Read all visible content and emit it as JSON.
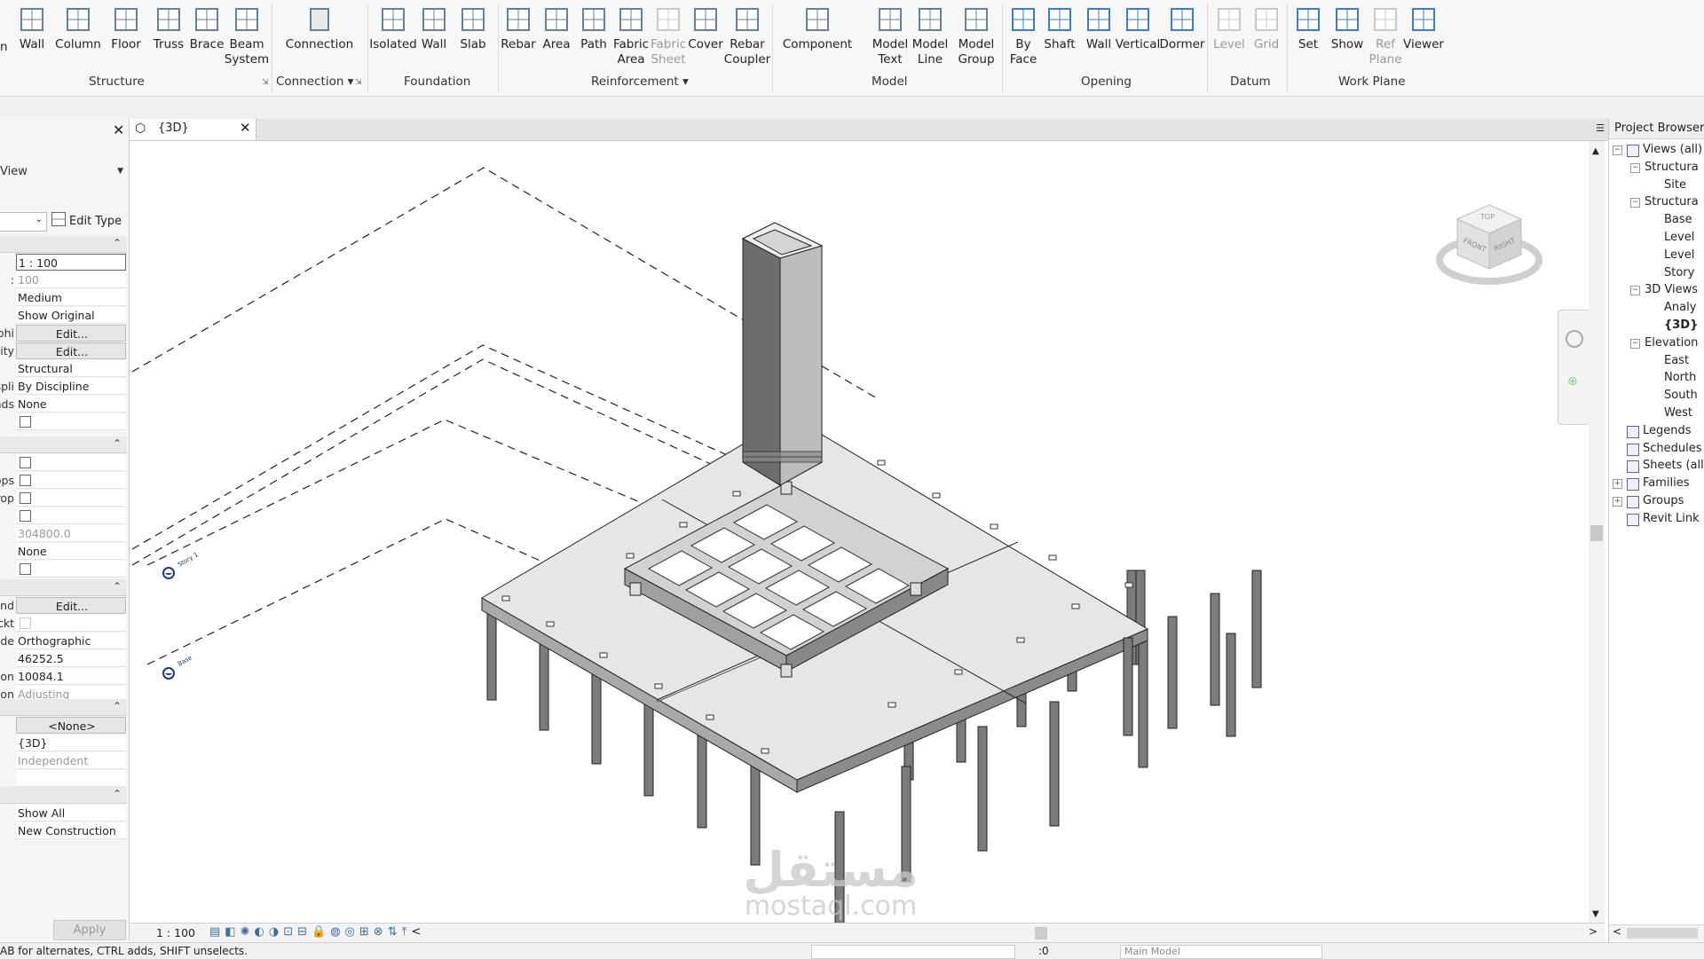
{
  "ribbon": {
    "structure": {
      "buttons": [
        "Wall",
        "Column",
        "Floor",
        "Truss",
        "Brace",
        "Beam\nSystem"
      ],
      "panel_label": "Structure",
      "partial_left": "n"
    },
    "connection": {
      "button": "Connection",
      "panel_label": "Connection ▾"
    },
    "foundation": {
      "buttons": [
        "Isolated",
        "Wall",
        "Slab"
      ],
      "panel_label": "Foundation"
    },
    "reinforcement": {
      "buttons": [
        "Rebar",
        "Area",
        "Path",
        "Fabric\nArea",
        "Fabric\nSheet",
        "Cover",
        "Rebar\nCoupler"
      ],
      "panel_label": "Reinforcement ▾"
    },
    "model": {
      "buttons": [
        "Component",
        "Model\nText",
        "Model\nLine",
        "Model\nGroup"
      ],
      "panel_label": "Model"
    },
    "opening": {
      "buttons": [
        "By\nFace",
        "Shaft",
        "Wall",
        "Vertical",
        "Dormer"
      ],
      "panel_label": "Opening"
    },
    "datum": {
      "buttons": [
        "Level",
        "Grid"
      ],
      "panel_label": "Datum"
    },
    "workplane": {
      "buttons": [
        "Set",
        "Show",
        "Ref\nPlane",
        "Viewer"
      ],
      "panel_label": "Work Plane"
    }
  },
  "properties": {
    "type_selector": "View",
    "edit_type": "Edit Type",
    "rows1": [
      {
        "label": "",
        "value": "1 : 100",
        "kind": "boxed"
      },
      {
        "label": ":",
        "value": "100",
        "kind": "gray"
      },
      {
        "label": "",
        "value": "Medium"
      },
      {
        "label": "",
        "value": "Show Original"
      },
      {
        "label": "Graphi...",
        "value": "Edit...",
        "kind": "btn"
      },
      {
        "label": "Visibility...",
        "value": "Edit...",
        "kind": "btn"
      },
      {
        "label": "",
        "value": "Structural"
      },
      {
        "label": "Displi...",
        "value": "By Discipline"
      },
      {
        "label": "Bounds...",
        "value": "None"
      },
      {
        "label": "",
        "value": "",
        "kind": "cb"
      }
    ],
    "rows2": [
      {
        "label": "",
        "value": "",
        "kind": "cb"
      },
      {
        "label": "Crops...",
        "value": "",
        "kind": "cb"
      },
      {
        "label": "Crop",
        "value": "",
        "kind": "cb"
      },
      {
        "label": "",
        "value": "",
        "kind": "cb"
      },
      {
        "label": "",
        "value": "304800.0",
        "kind": "gray"
      },
      {
        "label": "",
        "value": "None"
      },
      {
        "label": "",
        "value": "",
        "kind": "cb"
      }
    ],
    "rows3": [
      {
        "label": "Rend...",
        "value": "Edit...",
        "kind": "btn"
      },
      {
        "label": "Lockt...",
        "value": "",
        "kind": "cbgray"
      },
      {
        "label": "Mode",
        "value": "Orthographic"
      },
      {
        "label": "",
        "value": "46252.5"
      },
      {
        "label": "Elevation",
        "value": "10084.1"
      },
      {
        "label": "Position",
        "value": "Adjusting",
        "kind": "gray"
      }
    ],
    "rows4": [
      {
        "label": "",
        "value": "<None>",
        "kind": "btn"
      },
      {
        "label": "",
        "value": "{3D}"
      },
      {
        "label": "",
        "value": "Independent",
        "kind": "gray"
      },
      {
        "label": "",
        "value": ""
      }
    ],
    "rows5": [
      {
        "label": "",
        "value": "Show All"
      },
      {
        "label": "",
        "value": "New Construction"
      }
    ],
    "apply": "Apply"
  },
  "view": {
    "tab_label": "{3D}",
    "scale": "1 : 100",
    "viewcube": {
      "top": "TOP",
      "front": "FRONT",
      "right": "RIGHT"
    },
    "level_tags": [
      "Story 1",
      "Base"
    ]
  },
  "browser": {
    "title": "Project Browser -",
    "items": [
      {
        "text": "Views (all)",
        "indent": 0,
        "tog": "-",
        "icon": true
      },
      {
        "text": "Structura",
        "indent": 1,
        "tog": "-"
      },
      {
        "text": "Site",
        "indent": 2
      },
      {
        "text": "Structura",
        "indent": 1,
        "tog": "-"
      },
      {
        "text": "Base",
        "indent": 2
      },
      {
        "text": "Level",
        "indent": 2
      },
      {
        "text": "Level",
        "indent": 2
      },
      {
        "text": "Story",
        "indent": 2
      },
      {
        "text": "3D Views",
        "indent": 1,
        "tog": "-"
      },
      {
        "text": "Analy",
        "indent": 2
      },
      {
        "text": "{3D}",
        "indent": 2,
        "bold": true
      },
      {
        "text": "Elevation",
        "indent": 1,
        "tog": "-"
      },
      {
        "text": "East",
        "indent": 2
      },
      {
        "text": "North",
        "indent": 2
      },
      {
        "text": "South",
        "indent": 2
      },
      {
        "text": "West",
        "indent": 2
      },
      {
        "text": "Legends",
        "indent": 0,
        "icon": true
      },
      {
        "text": "Schedules",
        "indent": 0,
        "icon": true
      },
      {
        "text": "Sheets (all",
        "indent": 0,
        "icon": true
      },
      {
        "text": "Families",
        "indent": 0,
        "tog": "+",
        "icon": true
      },
      {
        "text": "Groups",
        "indent": 0,
        "tog": "+",
        "icon": true
      },
      {
        "text": "Revit Link",
        "indent": 0,
        "icon": true
      }
    ]
  },
  "status": {
    "hint": "AB for alternates, CTRL adds, SHIFT unselects.",
    "model": "Main Model",
    "zero": ":0"
  },
  "watermark": {
    "arabic": "مستقل",
    "latin": "mostaql.com"
  }
}
